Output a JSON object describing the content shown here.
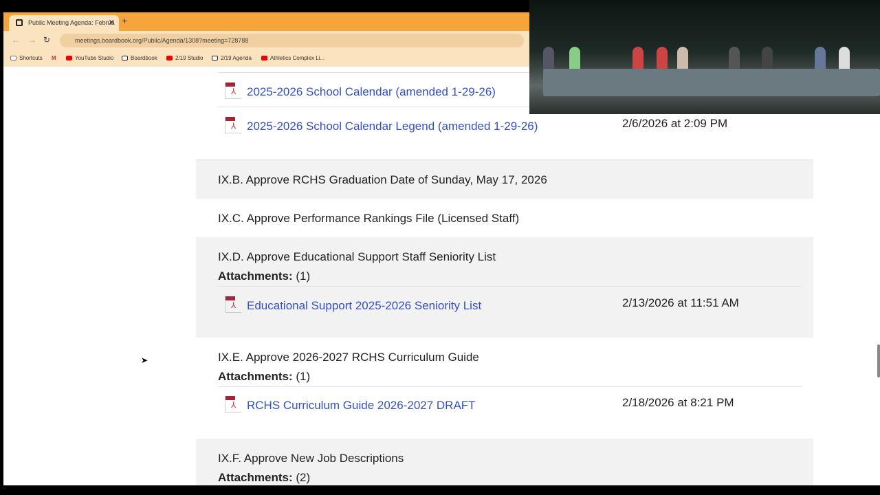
{
  "browser": {
    "tab_title": "Public Meeting Agenda: Februa",
    "url": "meetings.boardbook.org/Public/Agenda/1308?meeting=728788",
    "bookmarks": [
      "Shortcuts",
      "YouTube Studio",
      "Boardbook",
      "2/19 Studio",
      "2/19 Agenda",
      "Athletics Complex Li..."
    ]
  },
  "agenda": {
    "prev_attachments": [
      {
        "name": "2025-2026 School Calendar (amended 1-29-26)",
        "date": ""
      },
      {
        "name": "2025-2026 School Calendar Legend (amended 1-29-26)",
        "date": "2/6/2026 at 2:09 PM"
      }
    ],
    "attachments_label": "Attachments:",
    "items": [
      {
        "title": "IX.B. Approve RCHS Graduation Date of Sunday, May 17, 2026"
      },
      {
        "title": "IX.C. Approve Performance Rankings File (Licensed Staff)"
      },
      {
        "title": "IX.D. Approve Educational Support Staff Seniority List",
        "count": "(1)",
        "files": [
          {
            "name": "Educational Support 2025-2026 Seniority List",
            "date": "2/13/2026 at 11:51 AM"
          }
        ]
      },
      {
        "title": "IX.E. Approve 2026-2027 RCHS Curriculum Guide",
        "count": "(1)",
        "files": [
          {
            "name": "RCHS Curriculum Guide 2026-2027 DRAFT",
            "date": "2/18/2026 at 8:21 PM"
          }
        ]
      },
      {
        "title": "IX.F. Approve New Job Descriptions",
        "count": "(2)"
      }
    ]
  }
}
